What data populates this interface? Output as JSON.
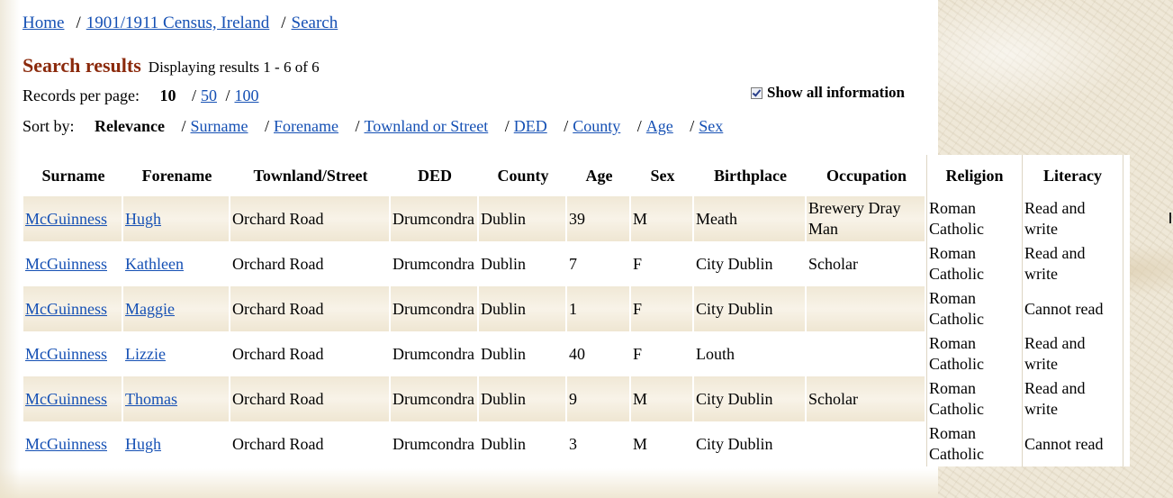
{
  "breadcrumb": {
    "home": "Home",
    "census": "1901/1911 Census, Ireland",
    "search": "Search",
    "separator": "/"
  },
  "results_header": {
    "heading": "Search results",
    "count_text": "Displaying results 1 - 6 of 6"
  },
  "per_page": {
    "label": "Records per page:",
    "current": "10",
    "options": [
      "50",
      "100"
    ]
  },
  "show_all": {
    "label": "Show all information",
    "checked": true
  },
  "sort_by": {
    "label": "Sort by:",
    "current": "Relevance",
    "options": [
      "Surname",
      "Forename",
      "Townland or Street",
      "DED",
      "County",
      "Age",
      "Sex"
    ]
  },
  "table": {
    "columns": [
      "Surname",
      "Forename",
      "Townland/Street",
      "DED",
      "County",
      "Age",
      "Sex",
      "Birthplace",
      "Occupation",
      "Religion",
      "Literacy"
    ],
    "rows": [
      {
        "surname": "McGuinness",
        "forename": "Hugh",
        "townland": "Orchard Road",
        "ded": "Drumcondra",
        "county": "Dublin",
        "age": "39",
        "sex": "M",
        "birthplace": "Meath",
        "occupation": "Brewery Dray Man",
        "religion": "Roman Catholic",
        "literacy": "Read and write"
      },
      {
        "surname": "McGuinness",
        "forename": "Kathleen",
        "townland": "Orchard Road",
        "ded": "Drumcondra",
        "county": "Dublin",
        "age": "7",
        "sex": "F",
        "birthplace": "City Dublin",
        "occupation": "Scholar",
        "religion": "Roman Catholic",
        "literacy": "Read and write"
      },
      {
        "surname": "McGuinness",
        "forename": "Maggie",
        "townland": "Orchard Road",
        "ded": "Drumcondra",
        "county": "Dublin",
        "age": "1",
        "sex": "F",
        "birthplace": "City Dublin",
        "occupation": "",
        "religion": "Roman Catholic",
        "literacy": "Cannot read"
      },
      {
        "surname": "McGuinness",
        "forename": "Lizzie",
        "townland": "Orchard Road",
        "ded": "Drumcondra",
        "county": "Dublin",
        "age": "40",
        "sex": "F",
        "birthplace": "Louth",
        "occupation": "",
        "religion": "Roman Catholic",
        "literacy": "Read and write"
      },
      {
        "surname": "McGuinness",
        "forename": "Thomas",
        "townland": "Orchard Road",
        "ded": "Drumcondra",
        "county": "Dublin",
        "age": "9",
        "sex": "M",
        "birthplace": "City Dublin",
        "occupation": "Scholar",
        "religion": "Roman Catholic",
        "literacy": "Read and write"
      },
      {
        "surname": "McGuinness",
        "forename": "Hugh",
        "townland": "Orchard Road",
        "ded": "Drumcondra",
        "county": "Dublin",
        "age": "3",
        "sex": "M",
        "birthplace": "City Dublin",
        "occupation": "",
        "religion": "Roman Catholic",
        "literacy": "Cannot read"
      }
    ]
  },
  "colors": {
    "link": "#1550b4",
    "heading": "#8b2a0c",
    "row_shade": "#f0e8d6",
    "background": "#efe8d8"
  }
}
